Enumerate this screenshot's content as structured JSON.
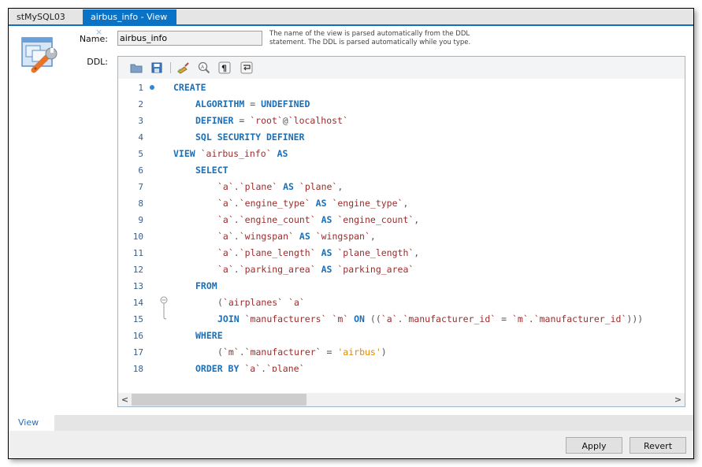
{
  "tabs": [
    {
      "label": "stMySQL03",
      "active": false
    },
    {
      "label": "airbus_info - View",
      "active": true,
      "close": "×"
    }
  ],
  "form": {
    "name_label": "Name:",
    "name_value": "airbus_info",
    "ddl_label": "DDL:",
    "hint": "The name of the view is parsed automatically from the DDL statement. The DDL is parsed automatically while you type."
  },
  "toolbar": {
    "icons": [
      "open-folder-icon",
      "save-icon",
      "beautify-icon",
      "find-icon",
      "invisible-chars-icon",
      "word-wrap-icon"
    ]
  },
  "code": {
    "lines": [
      {
        "n": "1",
        "indent": 0,
        "parts": [
          [
            "kw",
            "CREATE"
          ]
        ],
        "bookmark": true
      },
      {
        "n": "2",
        "indent": 1,
        "parts": [
          [
            "kw",
            "ALGORITHM"
          ],
          [
            "pun",
            " = "
          ],
          [
            "kw",
            "UNDEFINED"
          ]
        ]
      },
      {
        "n": "3",
        "indent": 1,
        "parts": [
          [
            "kw",
            "DEFINER"
          ],
          [
            "pun",
            " = "
          ],
          [
            "id",
            "`root`"
          ],
          [
            "pun",
            "@"
          ],
          [
            "id",
            "`localhost`"
          ]
        ]
      },
      {
        "n": "4",
        "indent": 1,
        "parts": [
          [
            "kw",
            "SQL SECURITY DEFINER"
          ]
        ]
      },
      {
        "n": "5",
        "indent": 0,
        "parts": [
          [
            "kw",
            "VIEW "
          ],
          [
            "id",
            "`airbus_info`"
          ],
          [
            "kw",
            " AS"
          ]
        ]
      },
      {
        "n": "6",
        "indent": 1,
        "parts": [
          [
            "kw",
            "SELECT"
          ]
        ]
      },
      {
        "n": "7",
        "indent": 2,
        "parts": [
          [
            "id",
            "`a`"
          ],
          [
            "pun",
            "."
          ],
          [
            "id",
            "`plane`"
          ],
          [
            "kw",
            " AS "
          ],
          [
            "id",
            "`plane`"
          ],
          [
            "pun",
            ","
          ]
        ]
      },
      {
        "n": "8",
        "indent": 2,
        "parts": [
          [
            "id",
            "`a`"
          ],
          [
            "pun",
            "."
          ],
          [
            "id",
            "`engine_type`"
          ],
          [
            "kw",
            " AS "
          ],
          [
            "id",
            "`engine_type`"
          ],
          [
            "pun",
            ","
          ]
        ]
      },
      {
        "n": "9",
        "indent": 2,
        "parts": [
          [
            "id",
            "`a`"
          ],
          [
            "pun",
            "."
          ],
          [
            "id",
            "`engine_count`"
          ],
          [
            "kw",
            " AS "
          ],
          [
            "id",
            "`engine_count`"
          ],
          [
            "pun",
            ","
          ]
        ]
      },
      {
        "n": "10",
        "indent": 2,
        "parts": [
          [
            "id",
            "`a`"
          ],
          [
            "pun",
            "."
          ],
          [
            "id",
            "`wingspan`"
          ],
          [
            "kw",
            " AS "
          ],
          [
            "id",
            "`wingspan`"
          ],
          [
            "pun",
            ","
          ]
        ]
      },
      {
        "n": "11",
        "indent": 2,
        "parts": [
          [
            "id",
            "`a`"
          ],
          [
            "pun",
            "."
          ],
          [
            "id",
            "`plane_length`"
          ],
          [
            "kw",
            " AS "
          ],
          [
            "id",
            "`plane_length`"
          ],
          [
            "pun",
            ","
          ]
        ]
      },
      {
        "n": "12",
        "indent": 2,
        "parts": [
          [
            "id",
            "`a`"
          ],
          [
            "pun",
            "."
          ],
          [
            "id",
            "`parking_area`"
          ],
          [
            "kw",
            " AS "
          ],
          [
            "id",
            "`parking_area`"
          ]
        ]
      },
      {
        "n": "13",
        "indent": 1,
        "parts": [
          [
            "kw",
            "FROM"
          ]
        ]
      },
      {
        "n": "14",
        "indent": 2,
        "parts": [
          [
            "pun",
            "("
          ],
          [
            "id",
            "`airplanes`"
          ],
          [
            "pun",
            " "
          ],
          [
            "id",
            "`a`"
          ]
        ],
        "fold": "start"
      },
      {
        "n": "15",
        "indent": 2,
        "parts": [
          [
            "kw",
            "JOIN "
          ],
          [
            "id",
            "`manufacturers`"
          ],
          [
            "pun",
            " "
          ],
          [
            "id",
            "`m`"
          ],
          [
            "kw",
            " ON "
          ],
          [
            "pun",
            "(("
          ],
          [
            "id",
            "`a`"
          ],
          [
            "pun",
            "."
          ],
          [
            "id",
            "`manufacturer_id`"
          ],
          [
            "pun",
            " = "
          ],
          [
            "id",
            "`m`"
          ],
          [
            "pun",
            "."
          ],
          [
            "id",
            "`manufacturer_id`"
          ],
          [
            "pun",
            ")))"
          ]
        ],
        "fold": "end"
      },
      {
        "n": "16",
        "indent": 1,
        "parts": [
          [
            "kw",
            "WHERE"
          ]
        ]
      },
      {
        "n": "17",
        "indent": 2,
        "parts": [
          [
            "pun",
            "("
          ],
          [
            "id",
            "`m`"
          ],
          [
            "pun",
            "."
          ],
          [
            "id",
            "`manufacturer`"
          ],
          [
            "pun",
            " = "
          ],
          [
            "str",
            "'airbus'"
          ],
          [
            "pun",
            ")"
          ]
        ]
      },
      {
        "n": "18",
        "indent": 1,
        "parts": [
          [
            "kw",
            "ORDER BY "
          ],
          [
            "id",
            "`a`"
          ],
          [
            "pun",
            "."
          ],
          [
            "id",
            "`plane`"
          ]
        ]
      }
    ]
  },
  "scroll": {
    "left_arrow": "<",
    "right_arrow": ">"
  },
  "bottom_tabs": [
    {
      "label": "View",
      "active": true
    }
  ],
  "buttons": {
    "apply": "Apply",
    "revert": "Revert"
  }
}
